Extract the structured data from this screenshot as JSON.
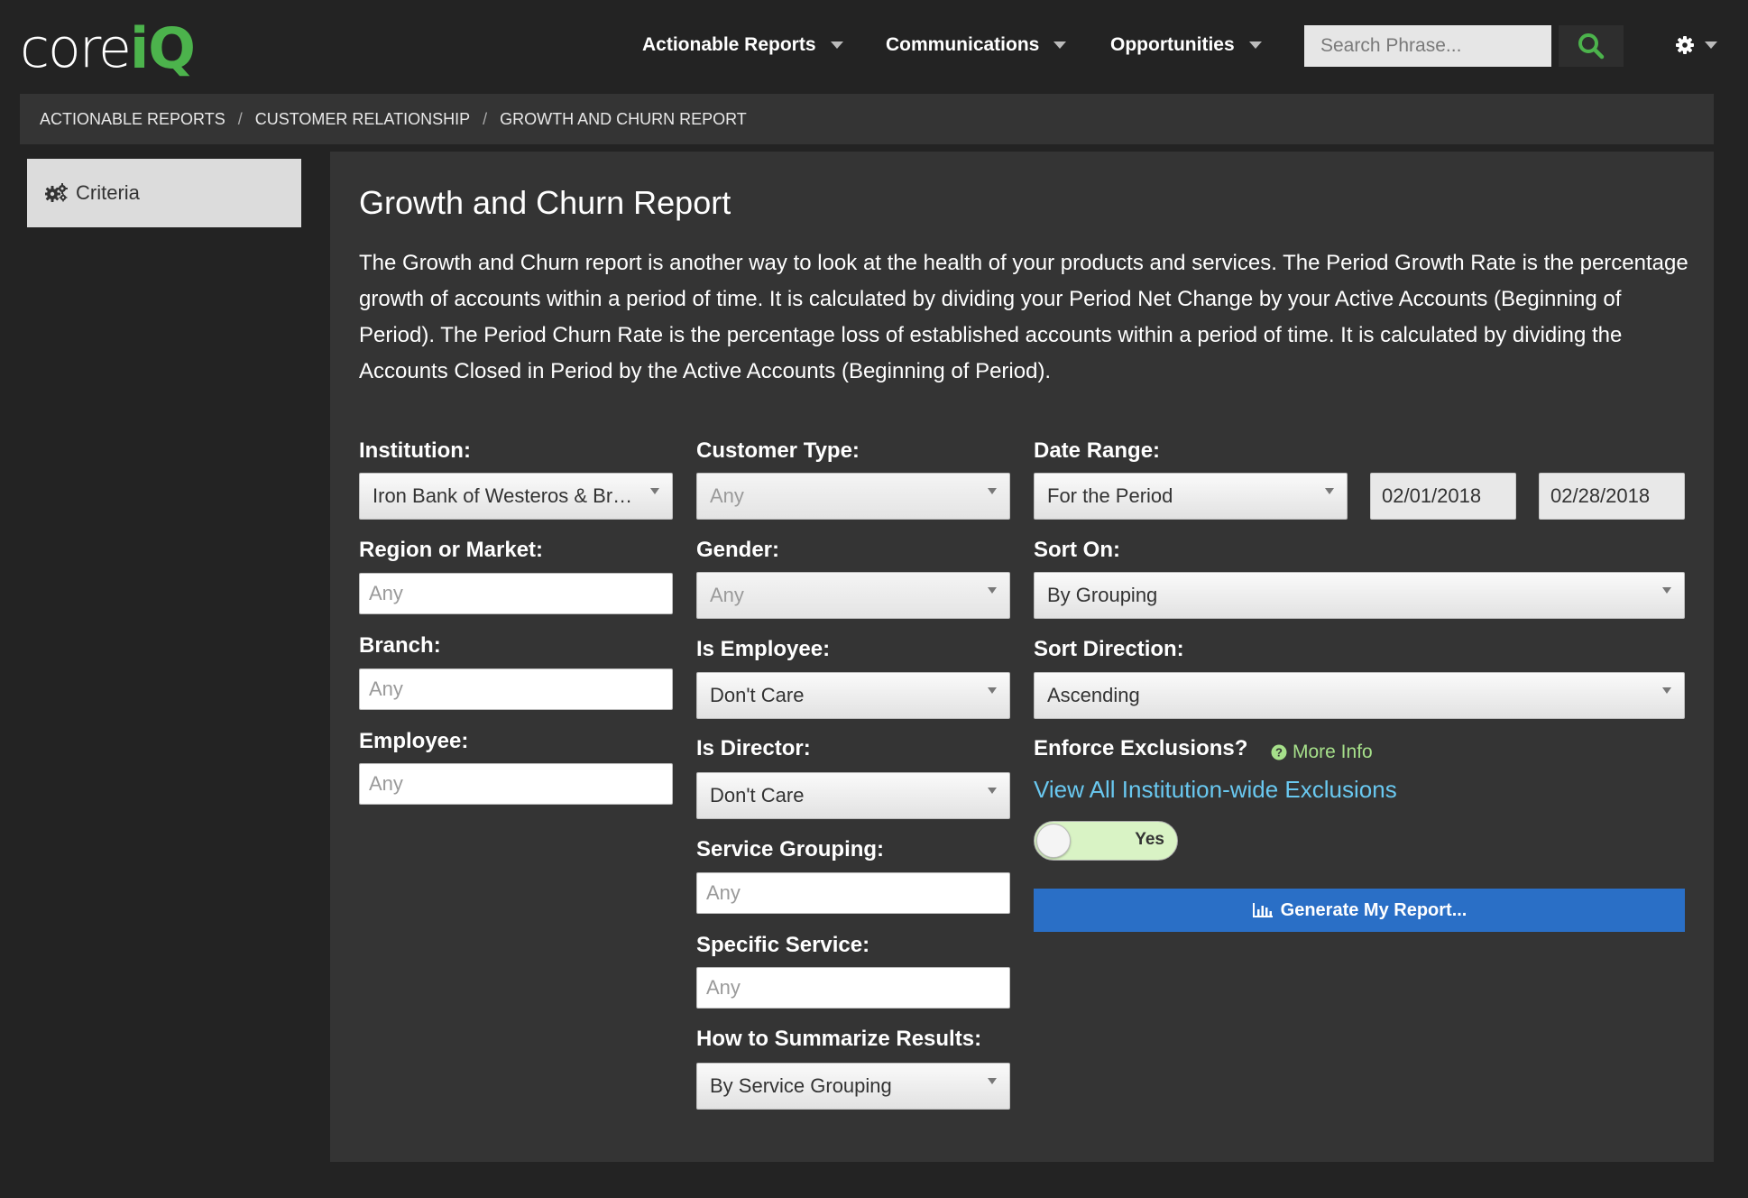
{
  "brand": {
    "logo_part1": "core",
    "logo_part2": "iQ",
    "accent_color": "#4cb34c"
  },
  "nav": {
    "items": [
      {
        "label": "Actionable Reports"
      },
      {
        "label": "Communications"
      },
      {
        "label": "Opportunities"
      }
    ],
    "search_placeholder": "Search Phrase...",
    "search_icon": "search-icon",
    "settings_icon": "gear-icon"
  },
  "breadcrumb": [
    "ACTIONABLE REPORTS",
    "CUSTOMER RELATIONSHIP",
    "GROWTH AND CHURN REPORT"
  ],
  "sidebar": {
    "criteria_label": "Criteria",
    "criteria_icon": "gears-icon"
  },
  "report": {
    "title": "Growth and Churn Report",
    "description": "The Growth and Churn report is another way to look at the health of your products and services. The Period Growth Rate is the percentage growth of accounts within a period of time. It is calculated by dividing your Period Net Change by your Active Accounts (Beginning of Period). The Period Churn Rate is the percentage loss of established accounts within a period of time. It is calculated by dividing the Accounts Closed in Period by the Active Accounts (Beginning of Period)."
  },
  "form": {
    "institution": {
      "label": "Institution:",
      "value": "Iron Bank of Westeros & Braavos"
    },
    "region": {
      "label": "Region or Market:",
      "placeholder": "Any"
    },
    "branch": {
      "label": "Branch:",
      "placeholder": "Any"
    },
    "employee": {
      "label": "Employee:",
      "placeholder": "Any"
    },
    "customer_type": {
      "label": "Customer Type:",
      "value": "Any"
    },
    "gender": {
      "label": "Gender:",
      "value": "Any"
    },
    "is_employee": {
      "label": "Is Employee:",
      "value": "Don't Care"
    },
    "is_director": {
      "label": "Is Director:",
      "value": "Don't Care"
    },
    "service_grouping": {
      "label": "Service Grouping:",
      "placeholder": "Any"
    },
    "specific_service": {
      "label": "Specific Service:",
      "placeholder": "Any"
    },
    "summarize": {
      "label": "How to Summarize Results:",
      "value": "By Service Grouping"
    },
    "date_range": {
      "label": "Date Range:",
      "value": "For the Period",
      "start": "02/01/2018",
      "end": "02/28/2018"
    },
    "sort_on": {
      "label": "Sort On:",
      "value": "By Grouping"
    },
    "sort_direction": {
      "label": "Sort Direction:",
      "value": "Ascending"
    },
    "enforce_exclusions": {
      "label": "Enforce Exclusions?",
      "more_info": "More Info",
      "view_all_link": "View All Institution-wide Exclusions",
      "toggle_label": "Yes"
    },
    "generate_button": "Generate My Report..."
  }
}
